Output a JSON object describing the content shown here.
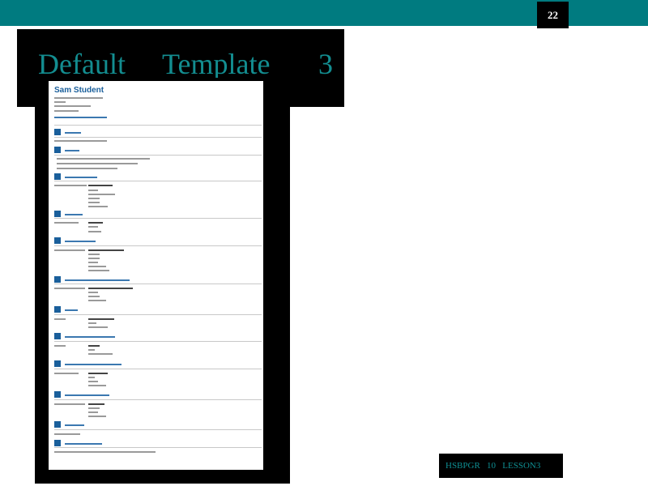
{
  "slide": {
    "page_number": "22",
    "title_words": [
      "Default",
      "Template",
      "3"
    ],
    "footer": "HSBPGR   10   LESSON3"
  },
  "resume": {
    "name": "Sam Student"
  },
  "colors": {
    "topbar": "#007b80",
    "title_text": "#138d90",
    "resume_accent": "#1a5f9b"
  }
}
